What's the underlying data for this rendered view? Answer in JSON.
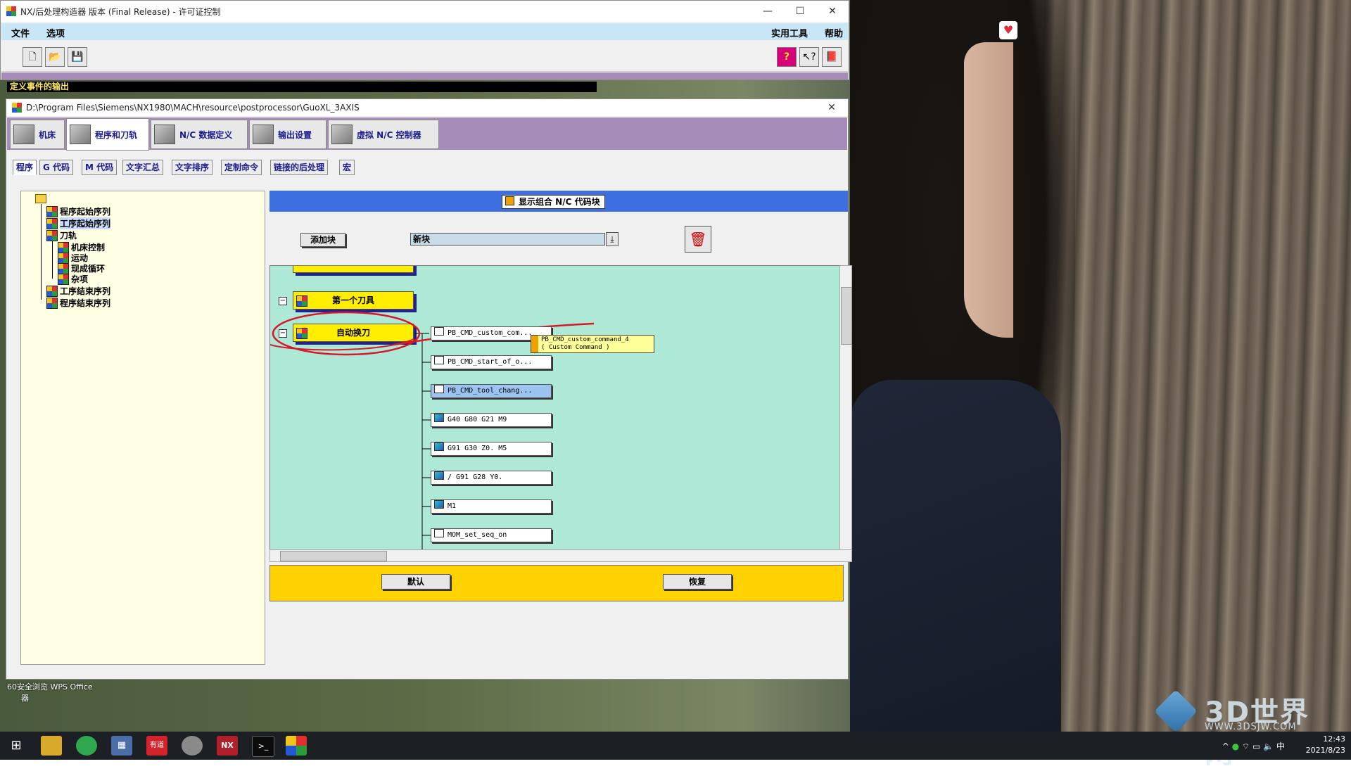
{
  "main_window": {
    "title": "NX/后处理构造器 版本 (Final Release) - 许可证控制",
    "menu_left": [
      "文件",
      "选项"
    ],
    "menu_right": [
      "实用工具",
      "帮助"
    ],
    "status_text": "定义事件的输出"
  },
  "child_window": {
    "title": "D:\\Program Files\\Siemens\\NX1980\\MACH\\resource\\postprocessor\\GuoXL_3AXIS",
    "main_tabs": [
      "机床",
      "程序和刀轨",
      "N/C 数据定义",
      "输出设置",
      "虚拟 N/C 控制器"
    ],
    "active_main_tab": 1,
    "sub_tabs": [
      "程序",
      "G 代码",
      "M 代码",
      "文字汇总",
      "文字排序",
      "定制命令",
      "链接的后处理",
      "宏"
    ],
    "active_sub_tab": 0
  },
  "tree": {
    "items": [
      "程序起始序列",
      "工序起始序列",
      "刀轨",
      "机床控制",
      "运动",
      "现成循环",
      "杂项",
      "工序结束序列",
      "程序结束序列"
    ],
    "selected": "工序起始序列"
  },
  "editor": {
    "combo_header_label": "显示组合 N/C 代码块",
    "add_block_label": "添加块",
    "new_block_value": "新块",
    "events": [
      "第一个刀具",
      "自动换刀"
    ],
    "blocks": [
      "PB_CMD_custom_com...",
      "PB_CMD_start_of_o...",
      "PB_CMD_tool_chang...",
      "G40 G80 G21 M9",
      "G91 G30 Z0. M5",
      "/ G91 G28 Y0.",
      "M1",
      "MOM_set_seq_on"
    ],
    "tooltip": [
      "PB_CMD_custom_command_4",
      "( Custom Command )"
    ],
    "default_label": "默认",
    "restore_label": "恢复"
  },
  "desktop": {
    "labels": "60安全浏览  WPS Office",
    "label_sub": "器",
    "watermark": "3D世界网",
    "watermark_url": "WWW.3DSJW.COM"
  },
  "taskbar": {
    "icons": [
      "windows-icon",
      "explorer-icon",
      "browser-icon",
      "calculator-icon",
      "youdao-icon",
      "paint-icon",
      "nx-icon",
      "terminal-icon",
      "postbuilder-icon"
    ],
    "time": "12:43",
    "date": "2021/8/23",
    "ime": "中"
  }
}
